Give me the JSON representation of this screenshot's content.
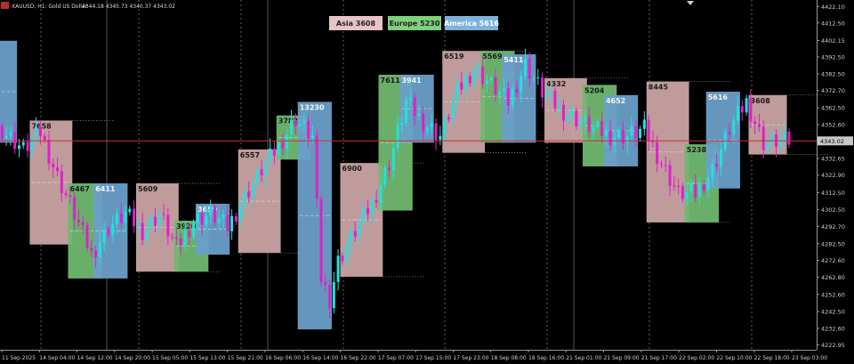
{
  "window": {
    "symbol_info": "XAUUSD, H1: Gold US Dollar",
    "ohlc_text": "4344.18 4345.73 4340.37 4343.02"
  },
  "legend": [
    {
      "label": "Asia 3608",
      "color": "#e6c4c4"
    },
    {
      "label": "Europe 5230",
      "color": "#7ecf7e"
    },
    {
      "label": "America 5616",
      "color": "#7fb2d8"
    }
  ],
  "colors": {
    "asia": "#c9a3a3",
    "europe": "#6fb86f",
    "america": "#6a9fc8",
    "bull": "#24e0e0",
    "bear": "#e020c8",
    "price_line": "#c83232",
    "background": "#000000"
  },
  "chart_data": {
    "type": "candlestick",
    "ylim": [
      4220,
      4426
    ],
    "y_ticks": [
      "4422.10",
      "4412.50",
      "4402.15",
      "4392.50",
      "4382.50",
      "4372.70",
      "4362.50",
      "4352.60",
      "4342.80",
      "4332.65",
      "4322.90",
      "4312.50",
      "4302.50",
      "4292.70",
      "4282.50",
      "4272.60",
      "4262.80",
      "4252.60",
      "4242.50",
      "4232.60",
      "4222.95"
    ],
    "current_price": "4343.02",
    "x_ticks": [
      "11 Sep 2025",
      "14 Sep 04:00",
      "14 Sep 12:00",
      "14 Sep 20:00",
      "15 Sep 05:00",
      "15 Sep 13:00",
      "15 Sep 21:00",
      "16 Sep 06:00",
      "16 Sep 14:00",
      "16 Sep 22:00",
      "17 Sep 07:00",
      "17 Sep 15:00",
      "17 Sep 23:00",
      "18 Sep 08:00",
      "18 Sep 16:00",
      "21 Sep 01:00",
      "21 Sep 09:00",
      "21 Sep 17:00",
      "22 Sep 02:00",
      "22 Sep 10:00",
      "22 Sep 18:00",
      "23 Sep 03:00"
    ],
    "sessions": [
      {
        "kind": "america",
        "label": "",
        "x0": -5,
        "x1": 4,
        "high": 4402,
        "low": 4342
      },
      {
        "kind": "asia",
        "label": "7658",
        "x0": 7,
        "x1": 17,
        "high": 4355,
        "low": 4282
      },
      {
        "kind": "europe",
        "label": "6467",
        "x0": 16,
        "x1": 24,
        "high": 4318,
        "low": 4262
      },
      {
        "kind": "america",
        "label": "6411",
        "x0": 22,
        "x1": 30,
        "high": 4318,
        "low": 4262
      },
      {
        "kind": "asia",
        "label": "5609",
        "x0": 32,
        "x1": 42,
        "high": 4318,
        "low": 4266
      },
      {
        "kind": "europe",
        "label": "3920",
        "x0": 41,
        "x1": 49,
        "high": 4296,
        "low": 4266
      },
      {
        "kind": "america",
        "label": "3659",
        "x0": 46,
        "x1": 54,
        "high": 4306,
        "low": 4276
      },
      {
        "kind": "asia",
        "label": "6557",
        "x0": 56,
        "x1": 66,
        "high": 4338,
        "low": 4277
      },
      {
        "kind": "europe",
        "label": "3782",
        "x0": 65,
        "x1": 73,
        "high": 4358,
        "low": 4332
      },
      {
        "kind": "america",
        "label": "13230",
        "x0": 70,
        "x1": 78,
        "high": 4366,
        "low": 4232
      },
      {
        "kind": "asia",
        "label": "6900",
        "x0": 80,
        "x1": 90,
        "high": 4330,
        "low": 4263
      },
      {
        "kind": "europe",
        "label": "7611",
        "x0": 89,
        "x1": 97,
        "high": 4382,
        "low": 4302
      },
      {
        "kind": "america",
        "label": "3941",
        "x0": 94,
        "x1": 102,
        "high": 4382,
        "low": 4342
      },
      {
        "kind": "asia",
        "label": "6519",
        "x0": 104,
        "x1": 114,
        "high": 4396,
        "low": 4336
      },
      {
        "kind": "europe",
        "label": "5569",
        "x0": 113,
        "x1": 121,
        "high": 4396,
        "low": 4342
      },
      {
        "kind": "america",
        "label": "5411",
        "x0": 118,
        "x1": 126,
        "high": 4394,
        "low": 4342
      },
      {
        "kind": "asia",
        "label": "4332",
        "x0": 128,
        "x1": 138,
        "high": 4380,
        "low": 4342
      },
      {
        "kind": "europe",
        "label": "5204",
        "x0": 137,
        "x1": 145,
        "high": 4376,
        "low": 4328
      },
      {
        "kind": "america",
        "label": "4652",
        "x0": 142,
        "x1": 150,
        "high": 4370,
        "low": 4328
      },
      {
        "kind": "asia",
        "label": "8445",
        "x0": 152,
        "x1": 162,
        "high": 4378,
        "low": 4295
      },
      {
        "kind": "europe",
        "label": "5238",
        "x0": 161,
        "x1": 169,
        "high": 4341,
        "low": 4295
      },
      {
        "kind": "america",
        "label": "5616",
        "x0": 166,
        "x1": 174,
        "high": 4372,
        "low": 4315
      },
      {
        "kind": "asia",
        "label": "3608",
        "x0": 176,
        "x1": 185,
        "high": 4370,
        "low": 4335
      }
    ],
    "candles": []
  }
}
